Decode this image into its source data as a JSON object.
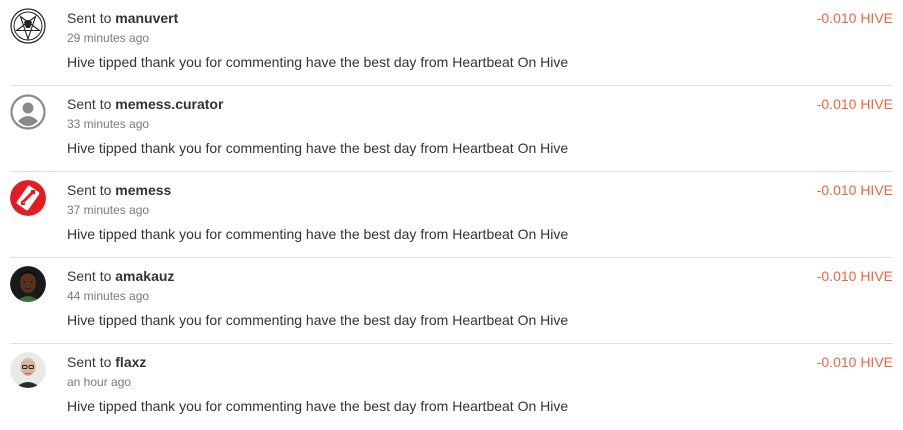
{
  "colors": {
    "amount": "#f0643c",
    "divider": "#e0e0e0",
    "memess_red": "#e31b23"
  },
  "transactions": [
    {
      "prefix": "Sent to",
      "recipient": "manuvert",
      "time": "29 minutes ago",
      "memo": "Hive tipped thank you for commenting have the best day from Heartbeat On Hive",
      "amount": "-0.010 HIVE",
      "avatar_icon": "pentagram-icon"
    },
    {
      "prefix": "Sent to",
      "recipient": "memess.curator",
      "time": "33 minutes ago",
      "memo": "Hive tipped thank you for commenting have the best day from Heartbeat On Hive",
      "amount": "-0.010 HIVE",
      "avatar_icon": "default-user-icon"
    },
    {
      "prefix": "Sent to",
      "recipient": "memess",
      "time": "37 minutes ago",
      "memo": "Hive tipped thank you for commenting have the best day from Heartbeat On Hive",
      "amount": "-0.010 HIVE",
      "avatar_icon": "memess-logo-icon"
    },
    {
      "prefix": "Sent to",
      "recipient": "amakauz",
      "time": "44 minutes ago",
      "memo": "Hive tipped thank you for commenting have the best day from Heartbeat On Hive",
      "amount": "-0.010 HIVE",
      "avatar_icon": "user-photo-icon"
    },
    {
      "prefix": "Sent to",
      "recipient": "flaxz",
      "time": "an hour ago",
      "memo": "Hive tipped thank you for commenting have the best day from Heartbeat On Hive",
      "amount": "-0.010 HIVE",
      "avatar_icon": "user-photo-icon"
    }
  ]
}
